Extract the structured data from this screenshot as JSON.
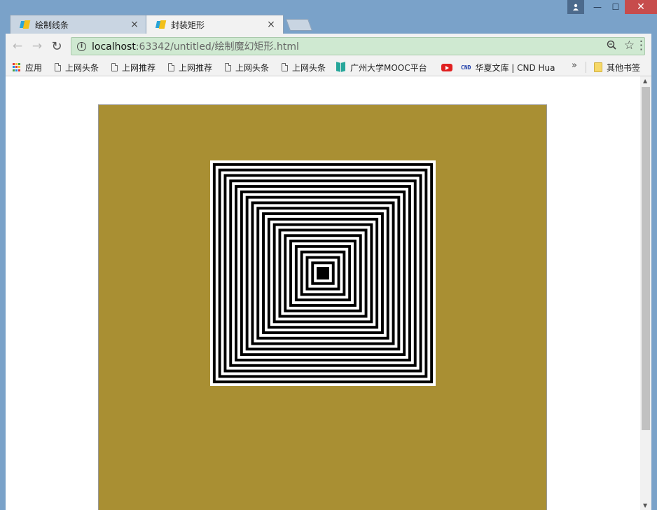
{
  "window": {
    "profile_icon": "person-icon",
    "minimize_glyph": "—",
    "maximize_glyph": "☐",
    "close_glyph": "✕"
  },
  "tabs": [
    {
      "title": "绘制线条",
      "active": false,
      "close": "×"
    },
    {
      "title": "封装矩形",
      "active": true,
      "close": "×"
    }
  ],
  "toolbar": {
    "back_glyph": "←",
    "forward_glyph": "→",
    "reload_glyph": "↻",
    "url_host": "localhost",
    "url_path": ":63342/untitled/绘制魔幻矩形.html",
    "zoom_glyph": "⚲",
    "star_glyph": "☆",
    "menu_glyph": "⋮"
  },
  "bookmarks": {
    "items": [
      {
        "label": "应用",
        "icon": "apps-icon"
      },
      {
        "label": "上网头条",
        "icon": "page-icon"
      },
      {
        "label": "上网推荐",
        "icon": "page-icon"
      },
      {
        "label": "上网推荐",
        "icon": "page-icon"
      },
      {
        "label": "上网头条",
        "icon": "page-icon"
      },
      {
        "label": "上网头条",
        "icon": "page-icon"
      },
      {
        "label": "广州大学MOOC平台",
        "icon": "book-icon"
      },
      {
        "label": "",
        "icon": "youtube-icon"
      },
      {
        "label": "华夏文库 | CND Hua",
        "icon": "cnd-icon",
        "icon_text": "CND"
      },
      {
        "label": "其他书签",
        "icon": "folder-icon"
      }
    ],
    "more_glyph": "»"
  },
  "canvas": {
    "background": "#a98f33",
    "stripe_dark": "#000000",
    "stripe_light": "#ffffff",
    "pattern": "concentric-squares",
    "ring_count": 20
  },
  "scrollbar": {
    "up_glyph": "▲",
    "down_glyph": "▼"
  }
}
